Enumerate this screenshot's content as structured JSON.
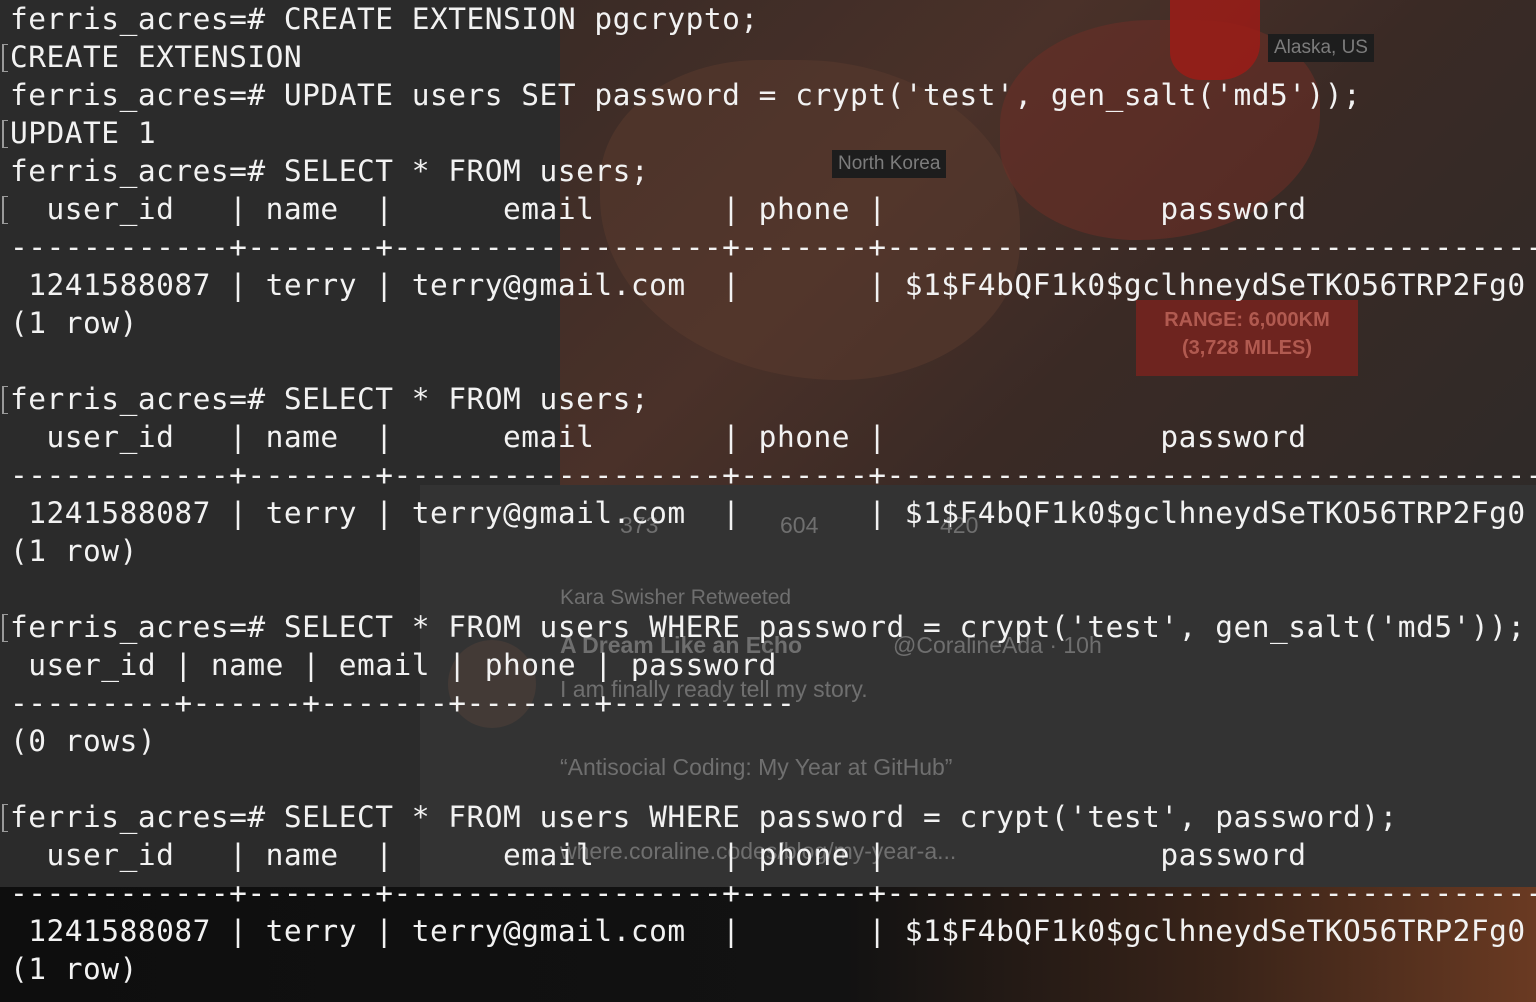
{
  "background": {
    "map_labels": {
      "alaska": "Alaska, US",
      "north_korea": "North Korea",
      "range_line1": "RANGE: 6,000KM",
      "range_line2": "(3,728 MILES)"
    },
    "tweet": {
      "count_replies": "373",
      "count_retweets": "604",
      "count_likes": "420",
      "retweeted_by": "Kara Swisher Retweeted",
      "author": "A Dream Like an Echo",
      "handle_time": "@CoralineAda · 10h",
      "text": "I am finally ready tell my story.",
      "quote": "“Antisocial Coding: My Year at GitHub”",
      "link": "where.coraline.codes/blog/my-year-a..."
    }
  },
  "terminal": {
    "lines": [
      "ferris_acres=# CREATE EXTENSION pgcrypto;",
      "CREATE EXTENSION",
      "ferris_acres=# UPDATE users SET password = crypt('test', gen_salt('md5'));",
      "UPDATE 1",
      "ferris_acres=# SELECT * FROM users;",
      "  user_id   | name  |      email       | phone |               password",
      "------------+-------+------------------+-------+------------------------------------",
      " 1241588087 | terry | terry@gmail.com  |       | $1$F4bQF1k0$gclhneydSeTKO56TRP2Fg0",
      "(1 row)",
      "",
      "ferris_acres=# SELECT * FROM users;",
      "  user_id   | name  |      email       | phone |               password",
      "------------+-------+------------------+-------+------------------------------------",
      " 1241588087 | terry | terry@gmail.com  |       | $1$F4bQF1k0$gclhneydSeTKO56TRP2Fg0",
      "(1 row)",
      "",
      "ferris_acres=# SELECT * FROM users WHERE password = crypt('test', gen_salt('md5'));",
      " user_id | name | email | phone | password",
      "---------+------+-------+-------+----------",
      "(0 rows)",
      "",
      "ferris_acres=# SELECT * FROM users WHERE password = crypt('test', password);",
      "  user_id   | name  |      email       | phone |               password",
      "------------+-------+------------------+-------+------------------------------------",
      " 1241588087 | terry | terry@gmail.com  |       | $1$F4bQF1k0$gclhneydSeTKO56TRP2Fg0",
      "(1 row)"
    ]
  }
}
